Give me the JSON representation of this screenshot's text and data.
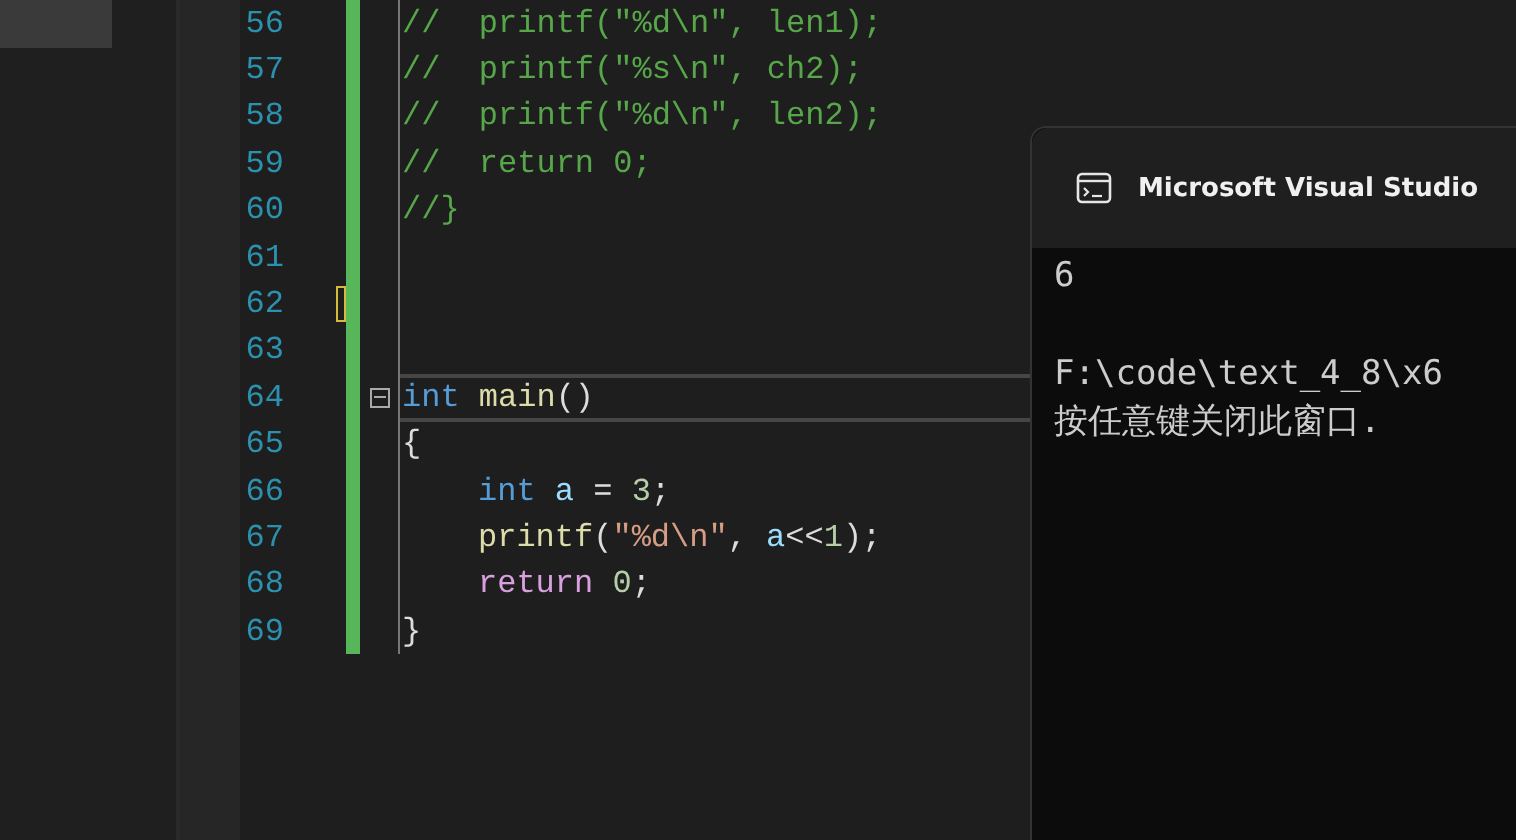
{
  "editor": {
    "lines": [
      {
        "number": "56",
        "highlighted": false,
        "foldable": false,
        "marker": false,
        "indented": false,
        "tokens": [
          {
            "kind": "comment",
            "text": "//  printf(\"%d\\n\", len1);"
          }
        ]
      },
      {
        "number": "57",
        "highlighted": false,
        "foldable": false,
        "marker": false,
        "indented": false,
        "tokens": [
          {
            "kind": "comment",
            "text": "//  printf(\"%s\\n\", ch2);"
          }
        ]
      },
      {
        "number": "58",
        "highlighted": false,
        "foldable": false,
        "marker": false,
        "indented": false,
        "tokens": [
          {
            "kind": "comment",
            "text": "//  printf(\"%d\\n\", len2);"
          }
        ]
      },
      {
        "number": "59",
        "highlighted": false,
        "foldable": false,
        "marker": false,
        "indented": false,
        "tokens": [
          {
            "kind": "comment",
            "text": "//  return 0;"
          }
        ]
      },
      {
        "number": "60",
        "highlighted": false,
        "foldable": false,
        "marker": false,
        "indented": false,
        "tokens": [
          {
            "kind": "comment",
            "text": "//}"
          }
        ]
      },
      {
        "number": "61",
        "highlighted": false,
        "foldable": false,
        "marker": false,
        "indented": false
      },
      {
        "number": "62",
        "highlighted": false,
        "foldable": false,
        "marker": true,
        "indented": false
      },
      {
        "number": "63",
        "highlighted": false,
        "foldable": false,
        "marker": false,
        "indented": false
      },
      {
        "number": "64",
        "highlighted": true,
        "foldable": true,
        "marker": false,
        "indented": false,
        "tokens": [
          {
            "kind": "keyword",
            "text": "int "
          },
          {
            "kind": "function",
            "text": "main"
          },
          {
            "kind": "plain",
            "text": "()"
          }
        ]
      },
      {
        "number": "65",
        "highlighted": false,
        "foldable": false,
        "marker": false,
        "indented": false,
        "tokens": [
          {
            "kind": "plain",
            "text": "{"
          }
        ]
      },
      {
        "number": "66",
        "highlighted": false,
        "foldable": false,
        "marker": false,
        "indented": true,
        "tokens": [
          {
            "kind": "keyword",
            "text": "int "
          },
          {
            "kind": "variable",
            "text": "a"
          },
          {
            "kind": "plain",
            "text": " = "
          },
          {
            "kind": "number",
            "text": "3"
          },
          {
            "kind": "plain",
            "text": ";"
          }
        ]
      },
      {
        "number": "67",
        "highlighted": false,
        "foldable": false,
        "marker": false,
        "indented": true,
        "tokens": [
          {
            "kind": "function",
            "text": "printf"
          },
          {
            "kind": "plain",
            "text": "("
          },
          {
            "kind": "string",
            "text": "\"%d\\n\""
          },
          {
            "kind": "plain",
            "text": ", "
          },
          {
            "kind": "variable",
            "text": "a"
          },
          {
            "kind": "plain",
            "text": "<<"
          },
          {
            "kind": "number",
            "text": "1"
          },
          {
            "kind": "plain",
            "text": ");"
          }
        ]
      },
      {
        "number": "68",
        "highlighted": false,
        "foldable": false,
        "marker": false,
        "indented": true,
        "tokens": [
          {
            "kind": "control",
            "text": "return "
          },
          {
            "kind": "number",
            "text": "0"
          },
          {
            "kind": "plain",
            "text": ";"
          }
        ]
      },
      {
        "number": "69",
        "highlighted": false,
        "foldable": false,
        "marker": false,
        "indented": false,
        "tokens": [
          {
            "kind": "plain",
            "text": "}"
          }
        ]
      }
    ]
  },
  "console": {
    "title": "Microsoft Visual Studio",
    "blocks": [
      [
        "6"
      ],
      [
        "F:\\code\\text_4_8\\x6",
        "按任意键关闭此窗口."
      ]
    ]
  }
}
